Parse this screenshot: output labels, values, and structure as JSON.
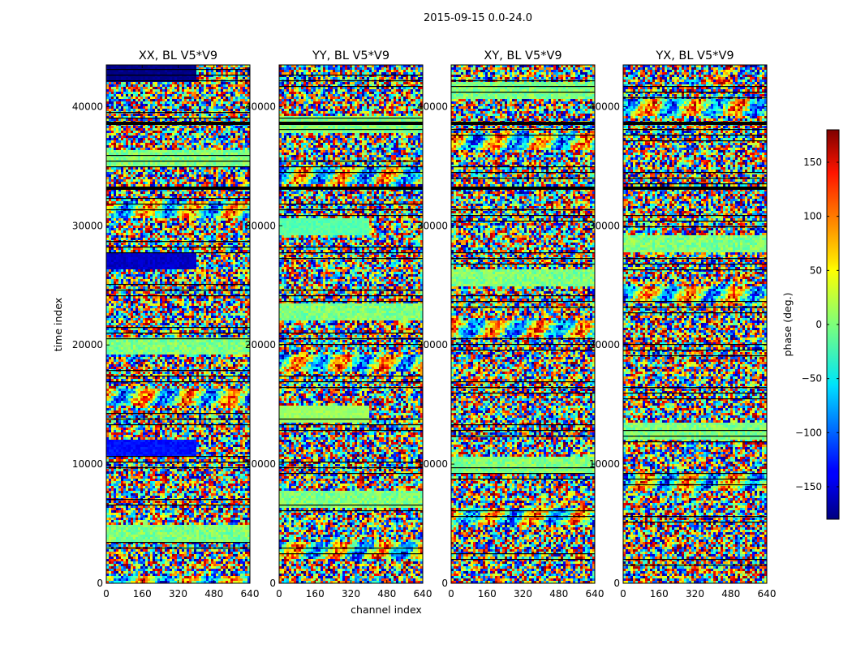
{
  "chart_data": {
    "type": "heatmap",
    "title": "2015-09-15 0.0-24.0",
    "xlabel": "channel index",
    "ylabel": "time index",
    "xlim": [
      0,
      640
    ],
    "ylim": [
      0,
      43500
    ],
    "x_ticks": [
      "0",
      "160",
      "320",
      "480",
      "640"
    ],
    "y_ticks": [
      "0",
      "10000",
      "20000",
      "30000",
      "40000"
    ],
    "panels": [
      {
        "name": "XX, BL V5*V9"
      },
      {
        "name": "YY, BL V5*V9"
      },
      {
        "name": "XY, BL V5*V9"
      },
      {
        "name": "YX, BL V5*V9"
      }
    ],
    "colorbar": {
      "label": "phase (deg.)",
      "colormap": "jet",
      "range": [
        -180,
        180
      ],
      "ticks": [
        "−150",
        "−100",
        "−50",
        "0",
        "50",
        "100",
        "150"
      ]
    }
  }
}
